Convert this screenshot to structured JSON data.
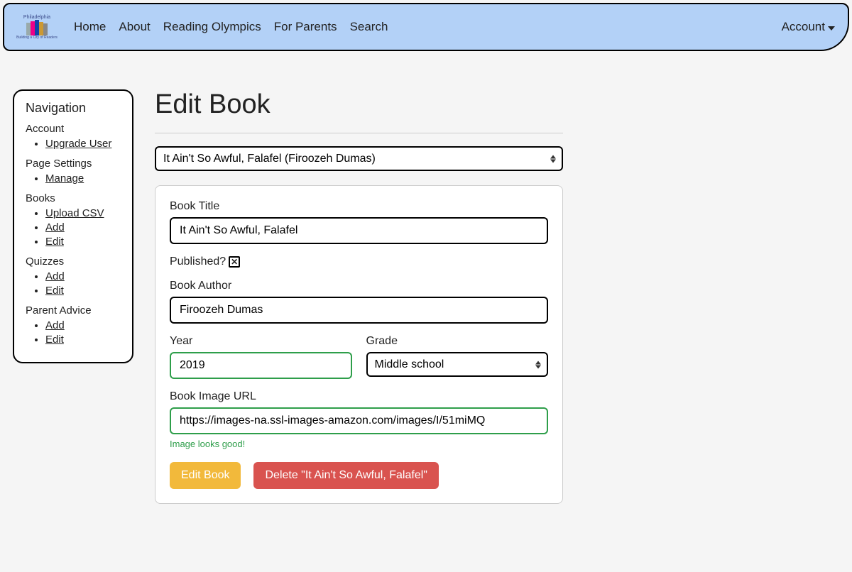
{
  "brand": {
    "top_text": "Philadelphia",
    "bottom_text": "Building a City of Readers"
  },
  "nav": {
    "links": [
      "Home",
      "About",
      "Reading Olympics",
      "For Parents",
      "Search"
    ],
    "account_label": "Account"
  },
  "sidebar": {
    "title": "Navigation",
    "sections": [
      {
        "title": "Account",
        "items": [
          "Upgrade User"
        ]
      },
      {
        "title": "Page Settings",
        "items": [
          "Manage"
        ]
      },
      {
        "title": "Books",
        "items": [
          "Upload CSV",
          "Add",
          "Edit"
        ]
      },
      {
        "title": "Quizzes",
        "items": [
          "Add",
          "Edit"
        ]
      },
      {
        "title": "Parent Advice",
        "items": [
          "Add",
          "Edit"
        ]
      }
    ]
  },
  "page": {
    "title": "Edit Book",
    "selected_book": "It Ain't So Awful, Falafel (Firoozeh Dumas)"
  },
  "form": {
    "title_label": "Book Title",
    "title_value": "It Ain't So Awful, Falafel",
    "published_label": "Published?",
    "published_checked": true,
    "author_label": "Book Author",
    "author_value": "Firoozeh Dumas",
    "year_label": "Year",
    "year_value": "2019",
    "grade_label": "Grade",
    "grade_value": "Middle school",
    "image_url_label": "Book Image URL",
    "image_url_value": "https://images-na.ssl-images-amazon.com/images/I/51miMQ",
    "image_valid_msg": "Image looks good!",
    "submit_label": "Edit Book",
    "delete_label": "Delete \"It Ain't So Awful, Falafel\""
  },
  "colors": {
    "nav_bg": "#b3d1f7",
    "valid_green": "#2e9e4a",
    "btn_warning": "#f2b93b",
    "btn_danger": "#d9534f"
  }
}
